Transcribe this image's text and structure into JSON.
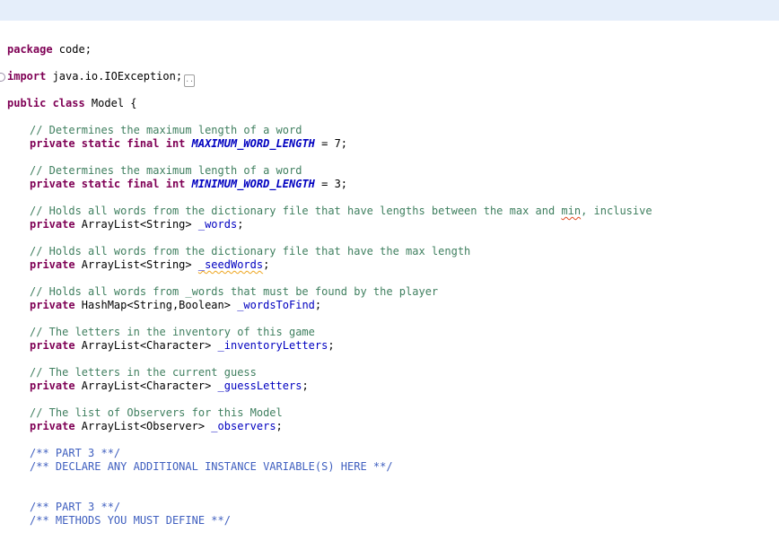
{
  "editor": {
    "background": "#ffffff",
    "current_line_highlight_color": "#e5eefa",
    "colors": {
      "keyword": "#7f0055",
      "comment": "#3f7f5f",
      "javadoc": "#3f5fbf",
      "field": "#0000c0",
      "constant": "#0000c0",
      "plain": "#000000",
      "spellcheck_error_squiggle": "#e0491f",
      "spellcheck_warning_squiggle": "#eea520"
    },
    "collapsed_region_label": "..",
    "lines": [
      {
        "highlight": true,
        "tokens": [
          {
            "s": "kw",
            "t": "package"
          },
          {
            "s": "pl",
            "t": " code;"
          }
        ]
      },
      {
        "tokens": []
      },
      {
        "fold_marker": true,
        "collapsed_box": true,
        "tokens": [
          {
            "s": "kw",
            "t": "import"
          },
          {
            "s": "pl",
            "t": " java.io.IOException;"
          }
        ]
      },
      {
        "tokens": []
      },
      {
        "tokens": [
          {
            "s": "kw",
            "t": "public class"
          },
          {
            "s": "pl",
            "t": " Model {"
          }
        ]
      },
      {
        "tokens": []
      },
      {
        "ind": 1,
        "tokens": [
          {
            "s": "cm",
            "t": "// Determines the maximum length of a word"
          }
        ]
      },
      {
        "ind": 1,
        "tokens": [
          {
            "s": "kw",
            "t": "private static final int"
          },
          {
            "s": "pl",
            "t": " "
          },
          {
            "s": "cst",
            "t": "MAXIMUM_WORD_LENGTH"
          },
          {
            "s": "pl",
            "t": " = 7;"
          }
        ]
      },
      {
        "tokens": []
      },
      {
        "ind": 1,
        "tokens": [
          {
            "s": "cm",
            "t": "// Determines the maximum length of a word"
          }
        ]
      },
      {
        "ind": 1,
        "tokens": [
          {
            "s": "kw",
            "t": "private static final int"
          },
          {
            "s": "pl",
            "t": " "
          },
          {
            "s": "cst",
            "t": "MINIMUM_WORD_LENGTH"
          },
          {
            "s": "pl",
            "t": " = 3;"
          }
        ]
      },
      {
        "tokens": []
      },
      {
        "ind": 1,
        "tokens": [
          {
            "s": "cm",
            "t": "// Holds all words from the dictionary file that have lengths between the max and "
          },
          {
            "s": "cm sq-red",
            "t": "min"
          },
          {
            "s": "cm",
            "t": ", inclusive"
          }
        ]
      },
      {
        "ind": 1,
        "tokens": [
          {
            "s": "kw",
            "t": "private"
          },
          {
            "s": "pl",
            "t": " ArrayList<String> "
          },
          {
            "s": "fld",
            "t": "_words"
          },
          {
            "s": "pl",
            "t": ";"
          }
        ]
      },
      {
        "tokens": []
      },
      {
        "ind": 1,
        "tokens": [
          {
            "s": "cm",
            "t": "// Holds all words from the dictionary file that have the max length"
          }
        ]
      },
      {
        "ind": 1,
        "tokens": [
          {
            "s": "kw",
            "t": "private"
          },
          {
            "s": "pl",
            "t": " ArrayList<String> "
          },
          {
            "s": "fld sq-org",
            "t": "_seedWords"
          },
          {
            "s": "pl",
            "t": ";"
          }
        ]
      },
      {
        "tokens": []
      },
      {
        "ind": 1,
        "tokens": [
          {
            "s": "cm",
            "t": "// Holds all words from _words that must be found by the player"
          }
        ]
      },
      {
        "ind": 1,
        "tokens": [
          {
            "s": "kw",
            "t": "private"
          },
          {
            "s": "pl",
            "t": " HashMap<String,Boolean> "
          },
          {
            "s": "fld",
            "t": "_wordsToFind"
          },
          {
            "s": "pl",
            "t": ";"
          }
        ]
      },
      {
        "tokens": []
      },
      {
        "ind": 1,
        "tokens": [
          {
            "s": "cm",
            "t": "// The letters in the inventory of this game"
          }
        ]
      },
      {
        "ind": 1,
        "tokens": [
          {
            "s": "kw",
            "t": "private"
          },
          {
            "s": "pl",
            "t": " ArrayList<Character> "
          },
          {
            "s": "fld",
            "t": "_inventoryLetters"
          },
          {
            "s": "pl",
            "t": ";"
          }
        ]
      },
      {
        "tokens": []
      },
      {
        "ind": 1,
        "tokens": [
          {
            "s": "cm",
            "t": "// The letters in the current guess"
          }
        ]
      },
      {
        "ind": 1,
        "tokens": [
          {
            "s": "kw",
            "t": "private"
          },
          {
            "s": "pl",
            "t": " ArrayList<Character> "
          },
          {
            "s": "fld",
            "t": "_guessLetters"
          },
          {
            "s": "pl",
            "t": ";"
          }
        ]
      },
      {
        "tokens": []
      },
      {
        "ind": 1,
        "tokens": [
          {
            "s": "cm",
            "t": "// The list of Observers for this Model"
          }
        ]
      },
      {
        "ind": 1,
        "tokens": [
          {
            "s": "kw",
            "t": "private"
          },
          {
            "s": "pl",
            "t": " ArrayList<Observer> "
          },
          {
            "s": "fld",
            "t": "_observers"
          },
          {
            "s": "pl",
            "t": ";"
          }
        ]
      },
      {
        "tokens": []
      },
      {
        "ind": 1,
        "tokens": [
          {
            "s": "jd",
            "t": "/** PART 3 **/"
          }
        ]
      },
      {
        "ind": 1,
        "tokens": [
          {
            "s": "jd",
            "t": "/** DECLARE ANY ADDITIONAL INSTANCE VARIABLE(S) HERE **/"
          }
        ]
      },
      {
        "tokens": []
      },
      {
        "tokens": []
      },
      {
        "ind": 1,
        "tokens": [
          {
            "s": "jd",
            "t": "/** PART 3 **/"
          }
        ]
      },
      {
        "ind": 1,
        "tokens": [
          {
            "s": "jd",
            "t": "/** METHODS YOU MUST DEFINE **/"
          }
        ]
      }
    ]
  }
}
